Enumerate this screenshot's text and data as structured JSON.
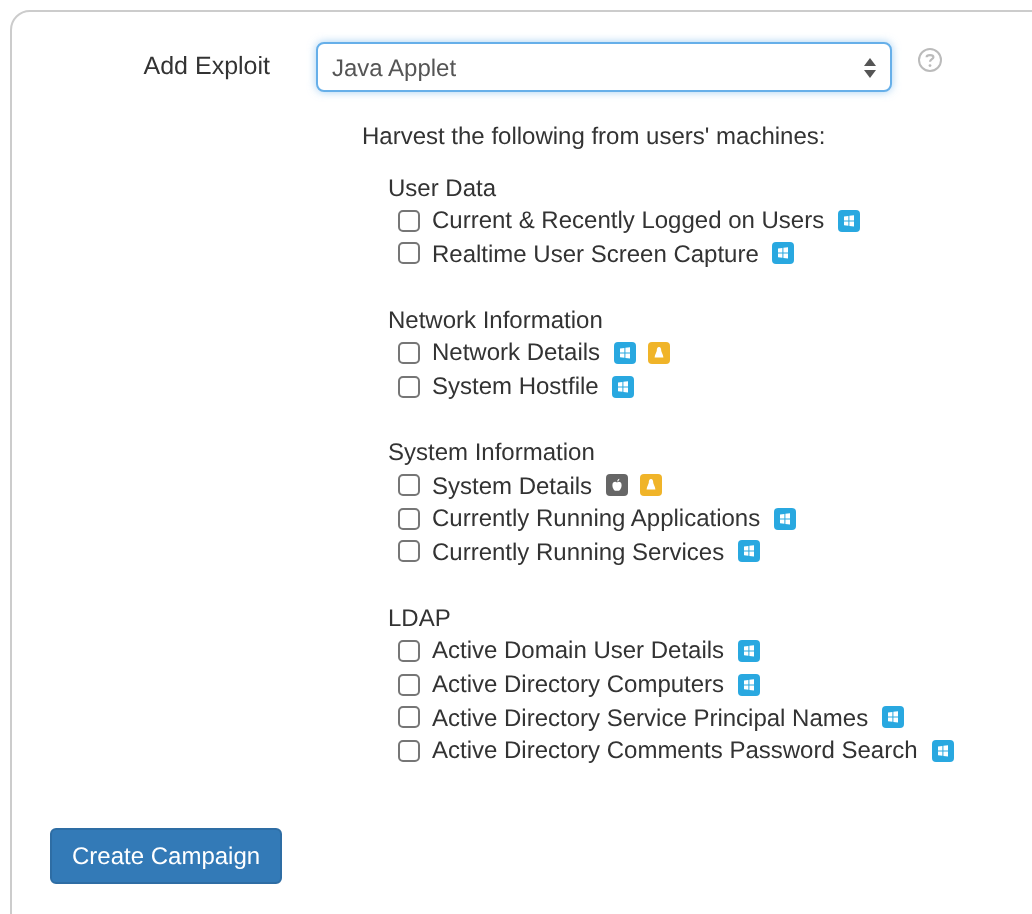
{
  "exploit": {
    "label": "Add Exploit",
    "value": "Java Applet"
  },
  "harvest_prompt": "Harvest the following from users' machines:",
  "groups": [
    {
      "title": "User Data",
      "items": [
        {
          "label": "Current & Recently Logged on Users",
          "checked": false,
          "platforms": [
            {
              "kind": "windows"
            }
          ]
        },
        {
          "label": "Realtime User Screen Capture",
          "checked": false,
          "platforms": [
            {
              "kind": "windows"
            }
          ]
        }
      ]
    },
    {
      "title": "Network Information",
      "items": [
        {
          "label": "Network Details",
          "checked": false,
          "platforms": [
            {
              "kind": "windows"
            },
            {
              "kind": "linux"
            }
          ]
        },
        {
          "label": "System Hostfile",
          "checked": false,
          "platforms": [
            {
              "kind": "windows"
            }
          ]
        }
      ]
    },
    {
      "title": "System Information",
      "items": [
        {
          "label": "System Details",
          "checked": false,
          "platforms": [
            {
              "kind": "apple"
            },
            {
              "kind": "linux"
            }
          ]
        },
        {
          "label": "Currently Running Applications",
          "checked": false,
          "platforms": [
            {
              "kind": "windows"
            }
          ]
        },
        {
          "label": "Currently Running Services",
          "checked": false,
          "platforms": [
            {
              "kind": "windows"
            }
          ]
        }
      ]
    },
    {
      "title": "LDAP",
      "items": [
        {
          "label": "Active Domain User Details",
          "checked": false,
          "platforms": [
            {
              "kind": "windows"
            }
          ]
        },
        {
          "label": "Active Directory Computers",
          "checked": false,
          "platforms": [
            {
              "kind": "windows"
            }
          ]
        },
        {
          "label": "Active Directory Service Principal Names",
          "checked": false,
          "platforms": [
            {
              "kind": "windows"
            }
          ]
        },
        {
          "label": "Active Directory Comments Password Search",
          "checked": false,
          "platforms": [
            {
              "kind": "windows"
            }
          ]
        }
      ]
    }
  ],
  "submit": "Create Campaign"
}
